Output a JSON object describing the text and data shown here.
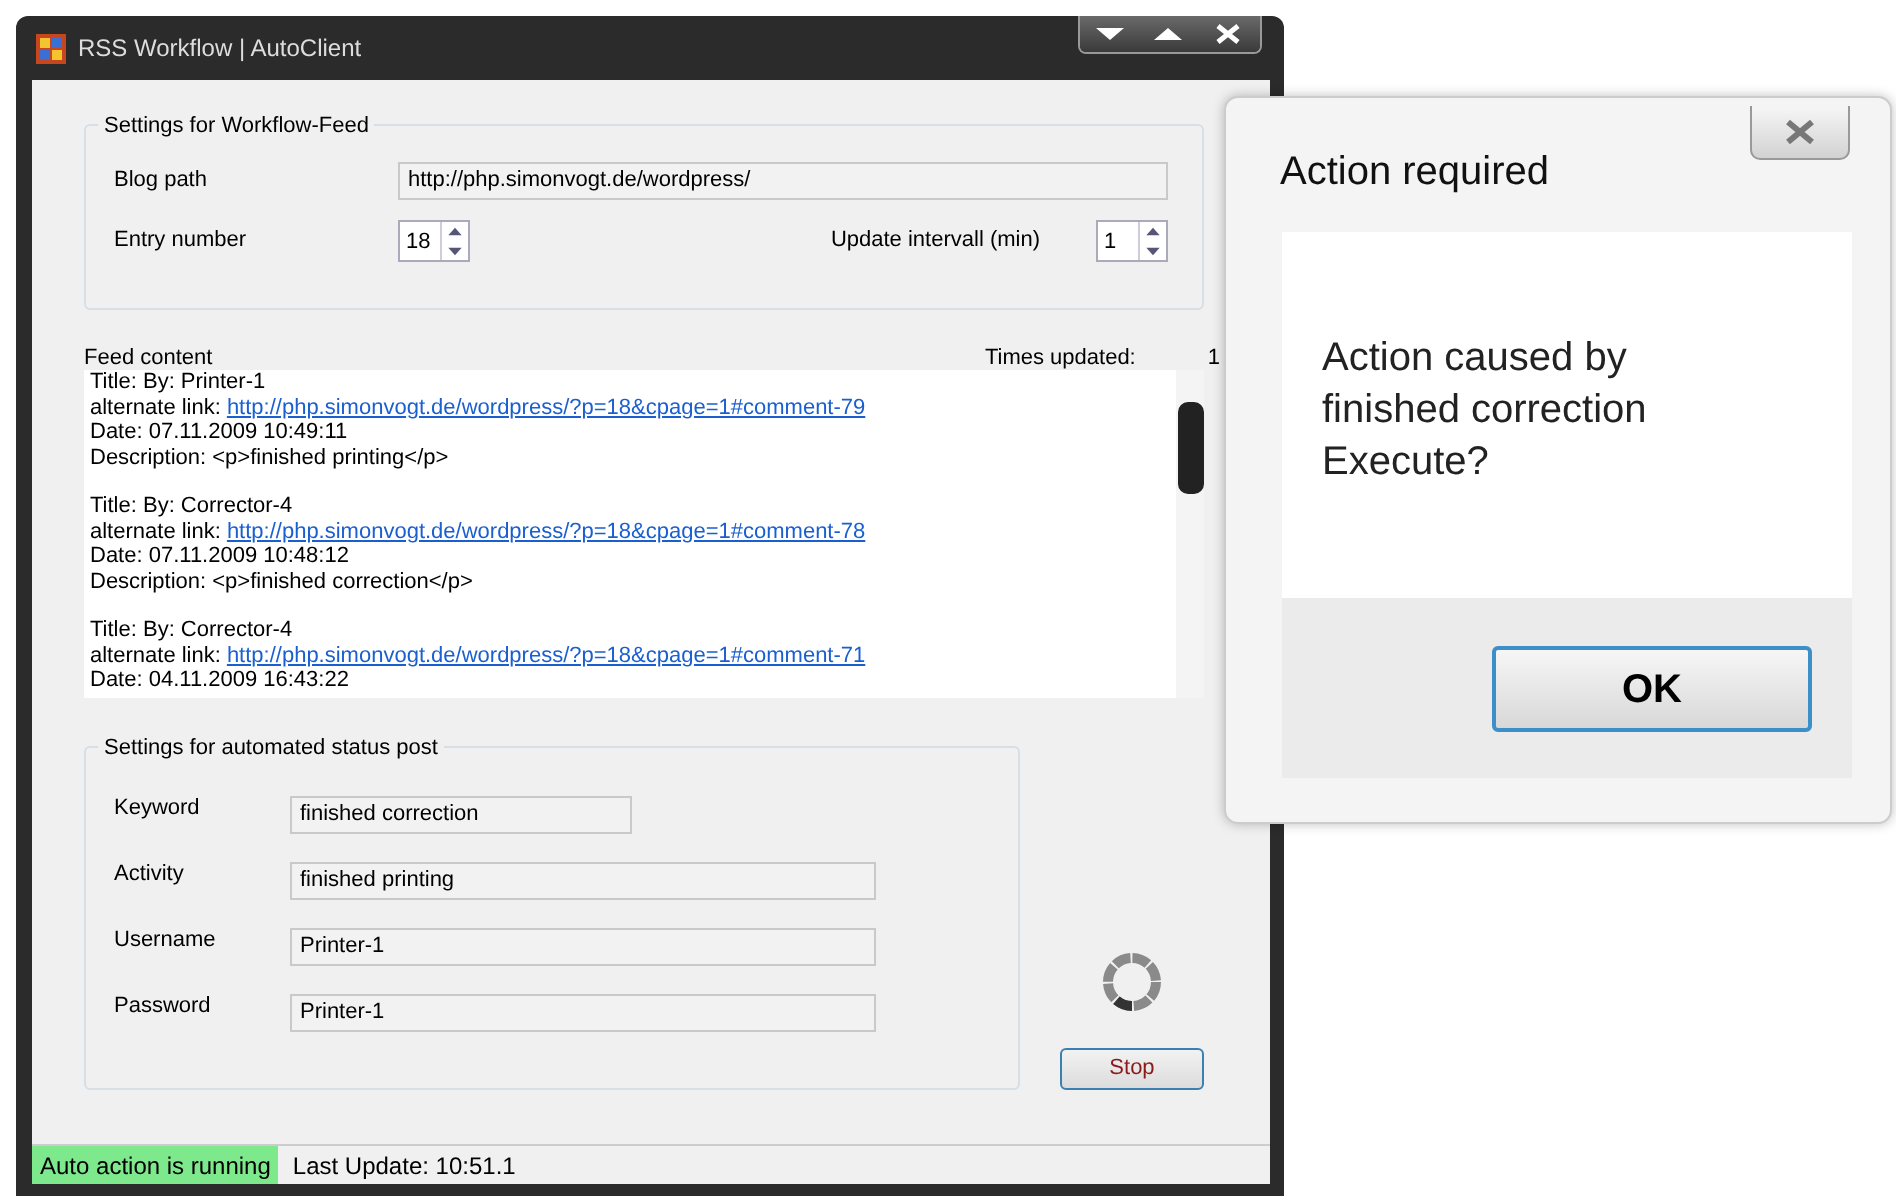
{
  "main_window": {
    "title": "RSS Workflow | AutoClient"
  },
  "feed_settings": {
    "title": "Settings for Workflow-Feed",
    "blog_path": {
      "label": "Blog path",
      "value": "http://php.simonvogt.de/wordpress/"
    },
    "entry_number": {
      "label": "Entry number",
      "value": "18"
    },
    "update_interval": {
      "label": "Update intervall (min)",
      "value": "1"
    }
  },
  "feed": {
    "label": "Feed content",
    "times_label": "Times updated:",
    "times_value": "1",
    "entries": [
      {
        "title": "Title: By: Printer-1",
        "link_label": "alternate link:",
        "link": "http://php.simonvogt.de/wordpress/?p=18&cpage=1#comment-79",
        "date": "Date: 07.11.2009 10:49:11",
        "description": "Description: <p>finished printing</p>"
      },
      {
        "title": "Title: By: Corrector-4",
        "link_label": "alternate link:",
        "link": "http://php.simonvogt.de/wordpress/?p=18&cpage=1#comment-78",
        "date": "Date: 07.11.2009 10:48:12",
        "description": "Description: <p>finished correction</p>"
      },
      {
        "title": "Title: By: Corrector-4",
        "link_label": "alternate link:",
        "link": "http://php.simonvogt.de/wordpress/?p=18&cpage=1#comment-71",
        "date": "Date: 04.11.2009 16:43:22"
      }
    ]
  },
  "status_post": {
    "title": "Settings for automated status post",
    "fields": [
      {
        "label": "Keyword",
        "value": "finished correction"
      },
      {
        "label": "Activity",
        "value": "finished printing"
      },
      {
        "label": "Username",
        "value": "Printer-1"
      },
      {
        "label": "Password",
        "value": "Printer-1"
      }
    ]
  },
  "stop_button": "Stop",
  "status_bar": [
    {
      "text": "Auto action is running",
      "kind": "highlight"
    },
    {
      "text": "Last Update: 10:51.1",
      "kind": "plain"
    }
  ],
  "dialog": {
    "title": "Action required",
    "message_lines": [
      "Action caused by",
      "finished correction",
      "Execute?"
    ],
    "button": "OK"
  }
}
